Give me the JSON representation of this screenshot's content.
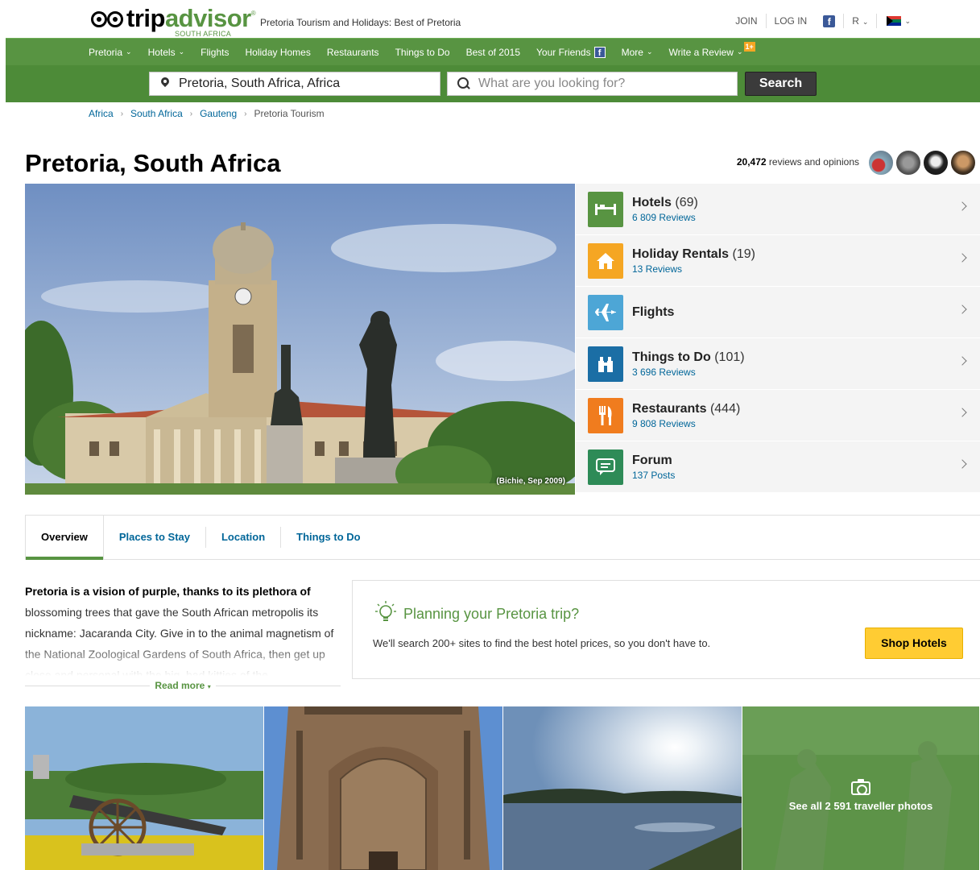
{
  "header": {
    "logo_trip": "trip",
    "logo_advisor": "advisor",
    "logo_sub": "SOUTH AFRICA",
    "tagline": "Pretoria Tourism and Holidays: Best of Pretoria",
    "join": "JOIN",
    "login": "LOG IN",
    "user_initial": "R"
  },
  "nav": {
    "items": [
      "Pretoria",
      "Hotels",
      "Flights",
      "Holiday Homes",
      "Restaurants",
      "Things to Do",
      "Best of 2015",
      "Your Friends",
      "More",
      "Write a Review"
    ],
    "badge": "1+"
  },
  "search": {
    "geo_value": "Pretoria, South Africa, Africa",
    "what_placeholder": "What are you looking for?",
    "button": "Search"
  },
  "breadcrumb": [
    "Africa",
    "South Africa",
    "Gauteng",
    "Pretoria Tourism"
  ],
  "page": {
    "title": "Pretoria, South Africa",
    "review_count": "20,472",
    "review_suffix": "reviews and opinions"
  },
  "hero": {
    "credit": "(Bichie, Sep 2009)"
  },
  "categories": [
    {
      "title": "Hotels",
      "count": "(69)",
      "sub": "6 809 Reviews",
      "color": "#589442",
      "icon": "bed-icon"
    },
    {
      "title": "Holiday Rentals",
      "count": "(19)",
      "sub": "13 Reviews",
      "color": "#f5a623",
      "icon": "home-icon"
    },
    {
      "title": "Flights",
      "count": "",
      "sub": "",
      "color": "#4da6d6",
      "icon": "plane-icon"
    },
    {
      "title": "Things to Do",
      "count": "(101)",
      "sub": "3 696 Reviews",
      "color": "#1b6ea5",
      "icon": "binoculars-icon"
    },
    {
      "title": "Restaurants",
      "count": "(444)",
      "sub": "9 808 Reviews",
      "color": "#f07c1e",
      "icon": "fork-knife-icon"
    },
    {
      "title": "Forum",
      "count": "",
      "sub": "137 Posts",
      "color": "#2e8b57",
      "icon": "chat-bubble-icon"
    }
  ],
  "tabs": [
    "Overview",
    "Places to Stay",
    "Location",
    "Things to Do"
  ],
  "overview": {
    "bold": "Pretoria is a vision of purple, thanks to its plethora of",
    "text": "blossoming trees that gave the South African metropolis its nickname: Jacaranda City. Give in to the animal magnetism of the National Zoological Gardens of South Africa, then get up close and personal with the big, bad kitties of the",
    "read_more": "Read more"
  },
  "plan": {
    "title": "Planning your Pretoria trip?",
    "desc": "We'll search 200+ sites to find the best hotel prices, so you don't have to.",
    "button": "Shop Hotels"
  },
  "gallery": {
    "see_all": "See all 2 591 traveller photos"
  },
  "colors": {
    "brand_green": "#589442",
    "link_blue": "#006699",
    "shop_yellow": "#ffcc33"
  }
}
